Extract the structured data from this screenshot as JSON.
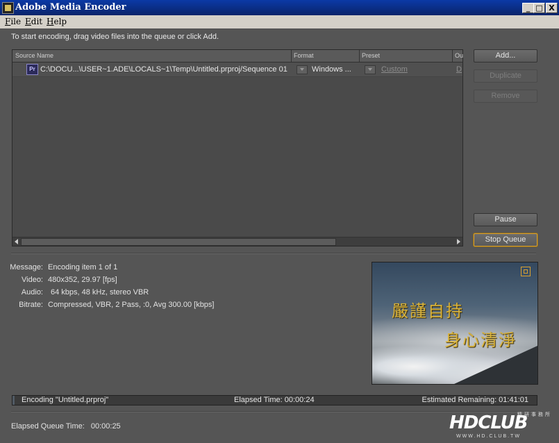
{
  "window": {
    "title": "Adobe Media Encoder",
    "min": "_",
    "max": "□",
    "close": "X"
  },
  "menu": [
    "File",
    "Edit",
    "Help"
  ],
  "instructions": "To start encoding, drag video files into the queue or click Add.",
  "queue": {
    "columns": [
      "Source Name",
      "Format",
      "Preset",
      "Ou"
    ],
    "rows": [
      {
        "icon": "Pr",
        "source": "C:\\DOCU...\\USER~1.ADE\\LOCALS~1\\Temp\\Untitled.prproj/Sequence 01",
        "format": "Windows ...",
        "preset": "Custom",
        "output": "D"
      }
    ]
  },
  "buttons": {
    "add": "Add...",
    "duplicate": "Duplicate",
    "remove": "Remove",
    "pause": "Pause",
    "stop": "Stop Queue"
  },
  "info": {
    "message_label": "Message:",
    "message": "Encoding item 1 of 1",
    "video_label": "Video:",
    "video": "480x352, 29.97 [fps]",
    "audio_label": "Audio:",
    "audio": "64 kbps, 48 kHz, stereo VBR",
    "bitrate_label": "Bitrate:",
    "bitrate": "Compressed, VBR, 2 Pass, :0, Avg 300.00 [kbps]"
  },
  "preview": {
    "caption1": "嚴謹自持",
    "caption2": "身心清淨"
  },
  "progress": {
    "encoding": "Encoding \"Untitled.prproj\"",
    "elapsed": "Elapsed Time: 00:00:24",
    "remaining": "Estimated Remaining: 01:41:01",
    "fraction": 0.004
  },
  "queue_time": {
    "label": "Elapsed Queue Time:",
    "value": "00:00:25"
  },
  "watermark": {
    "big": "HDCLUB",
    "small": "精研事務所",
    "url": "WWW.HD.CLUB.TW"
  }
}
